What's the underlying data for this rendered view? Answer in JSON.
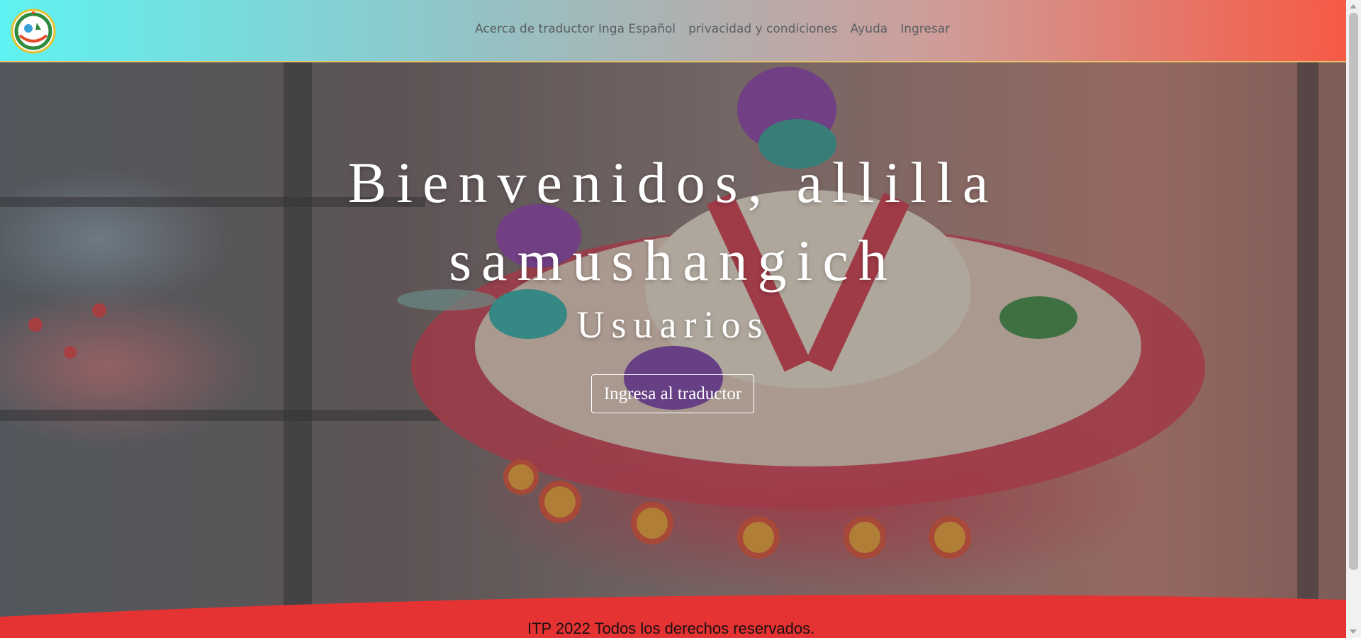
{
  "navbar": {
    "logo_icon": "itp-logo-icon",
    "links": [
      {
        "label": "Acerca de traductor Inga Español"
      },
      {
        "label": "privacidad y condiciones"
      },
      {
        "label": "Ayuda"
      },
      {
        "label": "Ingresar"
      }
    ],
    "gradient_colors": [
      "#5ff2f2",
      "#f65a45"
    ]
  },
  "hero": {
    "title_line1": "Bienvenidos, allilla",
    "title_line2": "samushangich",
    "subtitle": "Usuarios",
    "cta_label": "Ingresa al traductor"
  },
  "footer": {
    "text": "ITP 2022 Todos los derechos reservados.",
    "color": "#e53333"
  }
}
